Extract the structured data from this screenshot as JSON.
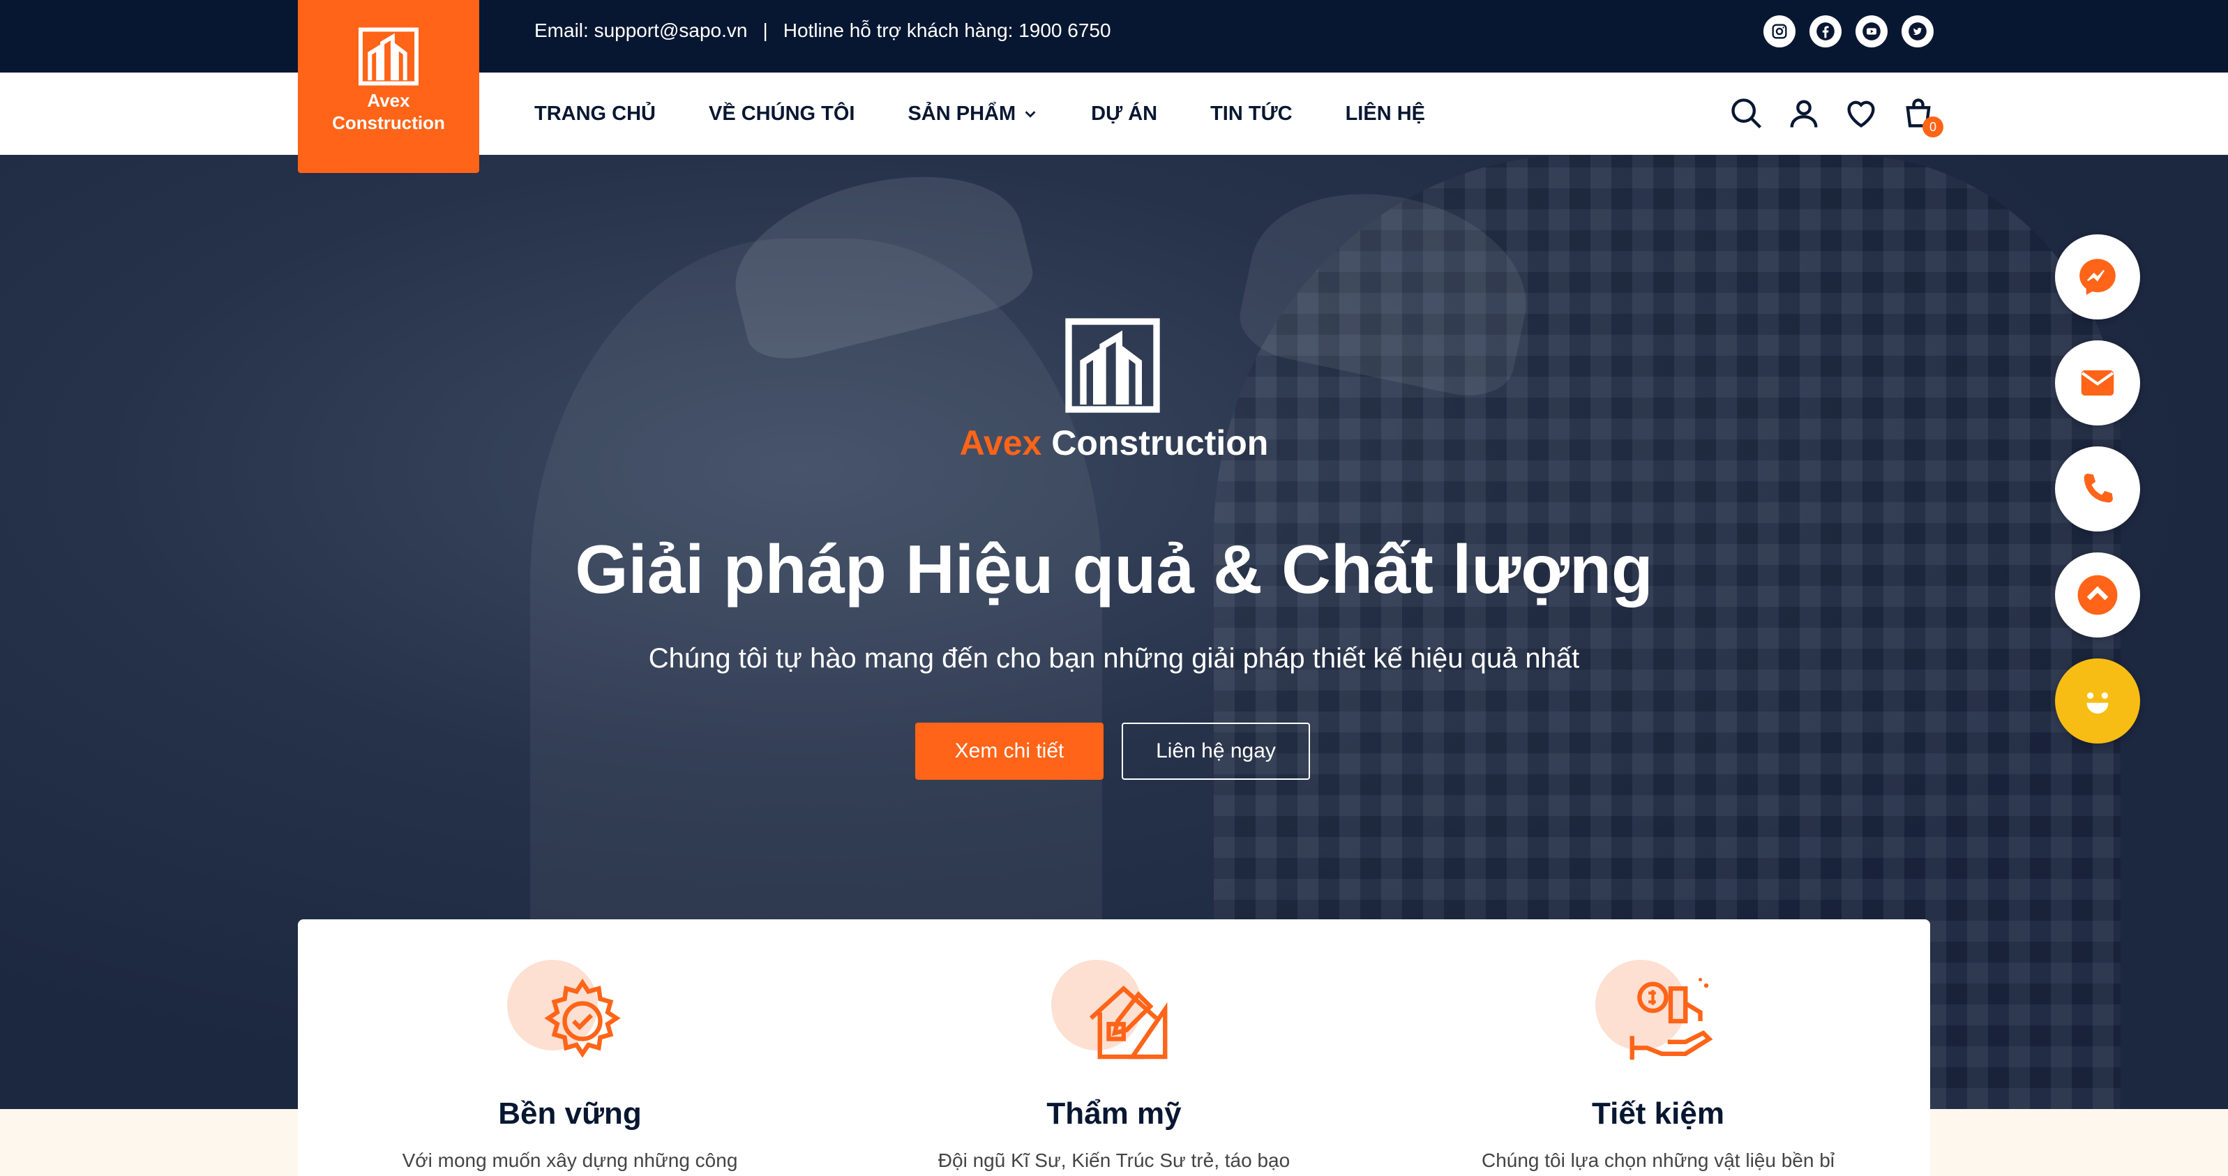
{
  "topbar": {
    "email": "Email: support@sapo.vn",
    "separator": "|",
    "hotline": "Hotline hỗ trợ khách hàng: 1900 6750",
    "socials": [
      "instagram-icon",
      "facebook-icon",
      "youtube-icon",
      "twitter-icon"
    ]
  },
  "logo": {
    "line1": "Avex",
    "line2": "Construction"
  },
  "nav": {
    "items": [
      {
        "label": "TRANG CHỦ"
      },
      {
        "label": "VỀ CHÚNG TÔI"
      },
      {
        "label": "SẢN PHẨM"
      },
      {
        "label": "DỰ ÁN"
      },
      {
        "label": "TIN TỨC"
      },
      {
        "label": "LIÊN HỆ"
      }
    ],
    "cart_count": "0"
  },
  "hero": {
    "brand_accent": "Avex",
    "brand_rest": "Construction",
    "title": "Giải pháp Hiệu quả & Chất lượng",
    "subtitle": "Chúng tôi tự hào mang đến cho bạn những giải pháp thiết kế hiệu quả nhất",
    "primary_button": "Xem chi tiết",
    "secondary_button": "Liên hệ ngay"
  },
  "floating": [
    "messenger-icon",
    "mail-icon",
    "phone-icon",
    "chevron-up-icon",
    "smile-icon"
  ],
  "features": [
    {
      "title": "Bền vững",
      "desc": "Với mong muốn xây dựng những công",
      "icon": "gear-check-icon"
    },
    {
      "title": "Thẩm mỹ",
      "desc": "Đội ngũ Kĩ Sư, Kiến Trúc Sư trẻ, táo bạo",
      "icon": "house-design-icon"
    },
    {
      "title": "Tiết kiệm",
      "desc": "Chúng tôi lựa chọn những vật liệu bền bỉ",
      "icon": "money-hand-icon"
    }
  ],
  "colors": {
    "accent": "#ff6418",
    "dark": "#081731",
    "hero_overlay": "#1c2740"
  }
}
